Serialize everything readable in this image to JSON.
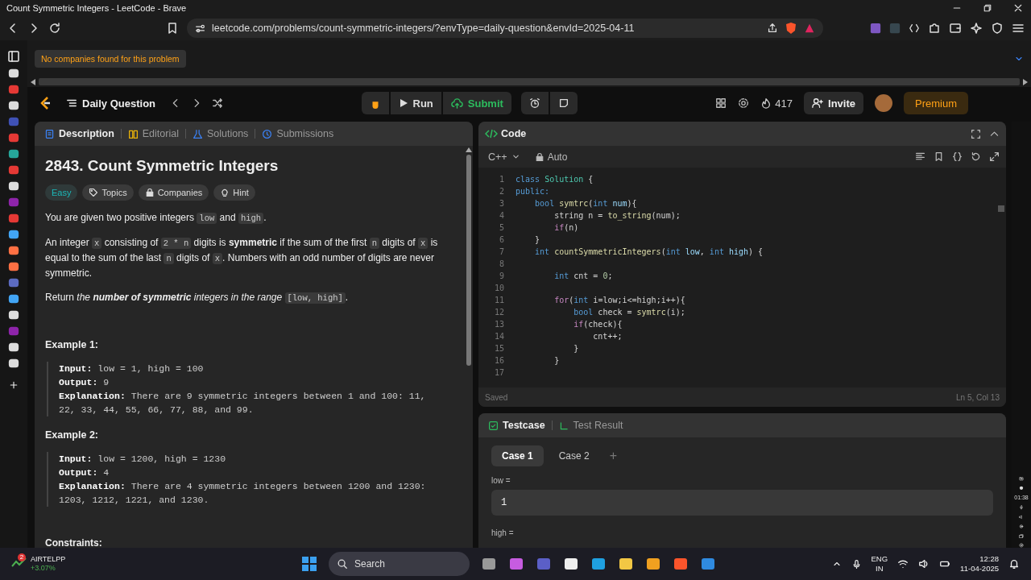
{
  "window": {
    "title": "Count Symmetric Integers - LeetCode - Brave"
  },
  "browser": {
    "url": "leetcode.com/problems/count-symmetric-integers/?envType=daily-question&envId=2025-04-11"
  },
  "banner": {
    "text": "No companies found for this problem"
  },
  "navbar": {
    "title": "Daily Question",
    "run": "Run",
    "submit": "Submit",
    "streak": "417",
    "invite": "Invite",
    "premium": "Premium"
  },
  "description_panel": {
    "tabs": [
      {
        "label": "Description",
        "selected": true
      },
      {
        "label": "Editorial",
        "selected": false
      },
      {
        "label": "Solutions",
        "selected": false
      },
      {
        "label": "Submissions",
        "selected": false
      }
    ],
    "title": "2843. Count Symmetric Integers",
    "tags": [
      {
        "label": "Easy",
        "kind": "difficulty"
      },
      {
        "label": "Topics",
        "kind": "topics"
      },
      {
        "label": "Companies",
        "kind": "companies"
      },
      {
        "label": "Hint",
        "kind": "hint"
      }
    ],
    "paragraphs": [
      [
        {
          "text": "You are given two positive integers ",
          "kind": "plain"
        },
        {
          "text": "low",
          "kind": "code"
        },
        {
          "text": " and ",
          "kind": "plain"
        },
        {
          "text": "high",
          "kind": "code"
        },
        {
          "text": ".",
          "kind": "plain"
        }
      ],
      [
        {
          "text": "An integer ",
          "kind": "plain"
        },
        {
          "text": "x",
          "kind": "code"
        },
        {
          "text": " consisting of ",
          "kind": "plain"
        },
        {
          "text": "2 * n",
          "kind": "code"
        },
        {
          "text": " digits is ",
          "kind": "plain"
        },
        {
          "text": "symmetric",
          "kind": "bold"
        },
        {
          "text": " if the sum of the first ",
          "kind": "plain"
        },
        {
          "text": "n",
          "kind": "code"
        },
        {
          "text": " digits of ",
          "kind": "plain"
        },
        {
          "text": "x",
          "kind": "code"
        },
        {
          "text": " is equal to the sum of the last ",
          "kind": "plain"
        },
        {
          "text": "n",
          "kind": "code"
        },
        {
          "text": " digits of ",
          "kind": "plain"
        },
        {
          "text": "x",
          "kind": "code"
        },
        {
          "text": ". Numbers with an odd number of digits are never symmetric.",
          "kind": "plain"
        }
      ],
      [
        {
          "text": "Return ",
          "kind": "plain"
        },
        {
          "text": "the ",
          "kind": "italic"
        },
        {
          "text": "number of symmetric",
          "kind": "bolditalic"
        },
        {
          "text": " integers in the range ",
          "kind": "italic"
        },
        {
          "text": "[low, high]",
          "kind": "code"
        },
        {
          "text": ".",
          "kind": "plain"
        }
      ]
    ],
    "examples": [
      {
        "heading": "Example 1:",
        "lines": [
          {
            "label": "Input:",
            "text": "low = 1, high = 100"
          },
          {
            "label": "Output:",
            "text": "9"
          },
          {
            "label": "Explanation:",
            "text": "There are 9 symmetric integers between 1 and 100: 11, 22, 33, 44, 55, 66, 77, 88, and 99."
          }
        ]
      },
      {
        "heading": "Example 2:",
        "lines": [
          {
            "label": "Input:",
            "text": "low = 1200, high = 1230"
          },
          {
            "label": "Output:",
            "text": "4"
          },
          {
            "label": "Explanation:",
            "text": "There are 4 symmetric integers between 1200 and 1230: 1203, 1212, 1221, and 1230."
          }
        ]
      }
    ],
    "constraints_heading": "Constraints:"
  },
  "code_panel": {
    "title": "Code",
    "language": "C++",
    "mode": "Auto",
    "status": "Saved",
    "cursor": "Ln 5, Col 13",
    "lines": [
      {
        "number": "1",
        "tokens": [
          {
            "text": "class ",
            "kind": "keyword"
          },
          {
            "text": "Solution",
            "kind": "type"
          },
          {
            "text": " {",
            "kind": "plain"
          }
        ]
      },
      {
        "number": "2",
        "tokens": [
          {
            "text": "public:",
            "kind": "keyword"
          }
        ]
      },
      {
        "number": "3",
        "tokens": [
          {
            "text": "    bool ",
            "kind": "keyword"
          },
          {
            "text": "symtrc",
            "kind": "function"
          },
          {
            "text": "(",
            "kind": "plain"
          },
          {
            "text": "int ",
            "kind": "keyword"
          },
          {
            "text": "num",
            "kind": "variable"
          },
          {
            "text": "){",
            "kind": "plain"
          }
        ]
      },
      {
        "number": "4",
        "tokens": [
          {
            "text": "        string n = ",
            "kind": "plain"
          },
          {
            "text": "to_string",
            "kind": "function"
          },
          {
            "text": "(num);",
            "kind": "plain"
          }
        ]
      },
      {
        "number": "5",
        "tokens": [
          {
            "text": "        if",
            "kind": "control"
          },
          {
            "text": "(n)",
            "kind": "plain"
          }
        ]
      },
      {
        "number": "6",
        "tokens": [
          {
            "text": "    }",
            "kind": "plain"
          }
        ]
      },
      {
        "number": "7",
        "tokens": [
          {
            "text": "    int ",
            "kind": "keyword"
          },
          {
            "text": "countSymmetricIntegers",
            "kind": "function"
          },
          {
            "text": "(",
            "kind": "plain"
          },
          {
            "text": "int ",
            "kind": "keyword"
          },
          {
            "text": "low",
            "kind": "variable"
          },
          {
            "text": ", ",
            "kind": "plain"
          },
          {
            "text": "int ",
            "kind": "keyword"
          },
          {
            "text": "high",
            "kind": "variable"
          },
          {
            "text": ") {",
            "kind": "plain"
          }
        ]
      },
      {
        "number": "8"
      },
      {
        "number": "9",
        "tokens": [
          {
            "text": "        int ",
            "kind": "keyword"
          },
          {
            "text": "cnt = ",
            "kind": "plain"
          },
          {
            "text": "0",
            "kind": "number"
          },
          {
            "text": ";",
            "kind": "plain"
          }
        ]
      },
      {
        "number": "10"
      },
      {
        "number": "11",
        "tokens": [
          {
            "text": "        for",
            "kind": "control"
          },
          {
            "text": "(",
            "kind": "plain"
          },
          {
            "text": "int ",
            "kind": "keyword"
          },
          {
            "text": "i=low;i<=high;i++){",
            "kind": "plain"
          }
        ]
      },
      {
        "number": "12",
        "tokens": [
          {
            "text": "            bool ",
            "kind": "keyword"
          },
          {
            "text": "check = ",
            "kind": "plain"
          },
          {
            "text": "symtrc",
            "kind": "function"
          },
          {
            "text": "(i);",
            "kind": "plain"
          }
        ]
      },
      {
        "number": "13",
        "tokens": [
          {
            "text": "            if",
            "kind": "control"
          },
          {
            "text": "(check){",
            "kind": "plain"
          }
        ]
      },
      {
        "number": "14",
        "tokens": [
          {
            "text": "                cnt++;",
            "kind": "plain"
          }
        ]
      },
      {
        "number": "15",
        "tokens": [
          {
            "text": "            }",
            "kind": "plain"
          }
        ]
      },
      {
        "number": "16",
        "tokens": [
          {
            "text": "        }",
            "kind": "plain"
          }
        ]
      },
      {
        "number": "17"
      }
    ]
  },
  "testcase_panel": {
    "tabs": [
      {
        "label": "Testcase",
        "selected": true
      },
      {
        "label": "Test Result",
        "selected": false
      }
    ],
    "cases": [
      {
        "label": "Case 1",
        "selected": true
      },
      {
        "label": "Case 2",
        "selected": false
      }
    ],
    "add": "+",
    "fields": [
      {
        "label": "low =",
        "value": "1"
      },
      {
        "label": "high ="
      }
    ]
  },
  "recorder": {
    "timer": "01:38"
  },
  "taskbar": {
    "widget_badge": "2",
    "widget_name": "AIRTELPP",
    "widget_change": "+3.07%",
    "search": "Search",
    "lang": "ENG",
    "region": "IN",
    "time": "12:28",
    "date": "11-04-2025"
  }
}
